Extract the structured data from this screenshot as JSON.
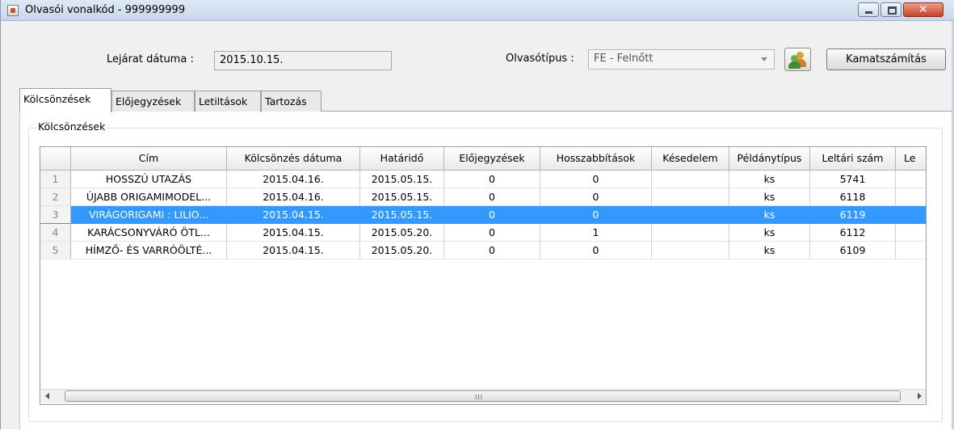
{
  "window": {
    "title": "Olvasói vonalkód - 999999999"
  },
  "header": {
    "expiry_label": "Lejárat dátuma :",
    "expiry_value": "2015.10.15.",
    "reader_type_label": "Olvasótípus :",
    "reader_type_value": "FE - Felnőtt",
    "interest_button": "Kamatszámítás"
  },
  "tabs": [
    {
      "label": "Kölcsönzések",
      "active": true
    },
    {
      "label": "Előjegyzések",
      "active": false
    },
    {
      "label": "Letiltások",
      "active": false
    },
    {
      "label": "Tartozás",
      "active": false
    }
  ],
  "group_title": "Kölcsönzések",
  "table": {
    "columns": [
      "",
      "Cím",
      "Kölcsönzés dátuma",
      "Határidő",
      "Előjegyzések",
      "Hosszabbítások",
      "Késedelem",
      "Példánytípus",
      "Leltári szám",
      "Le"
    ],
    "rows": [
      [
        "1",
        "HOSSZÚ UTAZÁS",
        "2015.04.16.",
        "2015.05.15.",
        "0",
        "0",
        "",
        "ks",
        "5741",
        ""
      ],
      [
        "2",
        "ÚJABB ORIGAMIMODEL...",
        "2015.04.16.",
        "2015.05.15.",
        "0",
        "0",
        "",
        "ks",
        "6118",
        ""
      ],
      [
        "3",
        "VIRÁGORIGAMI : LILIO...",
        "2015.04.15.",
        "2015.05.15.",
        "0",
        "0",
        "",
        "ks",
        "6119",
        ""
      ],
      [
        "4",
        "KARÁCSONYVÁRÓ ÖTL...",
        "2015.04.15.",
        "2015.05.20.",
        "0",
        "1",
        "",
        "ks",
        "6112",
        ""
      ],
      [
        "5",
        "HÍMZŐ- ÉS VARRÓÖLTÉ...",
        "2015.04.15.",
        "2015.05.20.",
        "0",
        "0",
        "",
        "ks",
        "6109",
        ""
      ]
    ],
    "selected_row": 2,
    "scrollbar_grip": "III"
  },
  "colors": {
    "selection": "#3399ff",
    "title_bar": "#dfe9f5",
    "close_button": "#c7412a"
  },
  "icons": {
    "app": "java-cup-icon",
    "reader": "users-icon"
  }
}
